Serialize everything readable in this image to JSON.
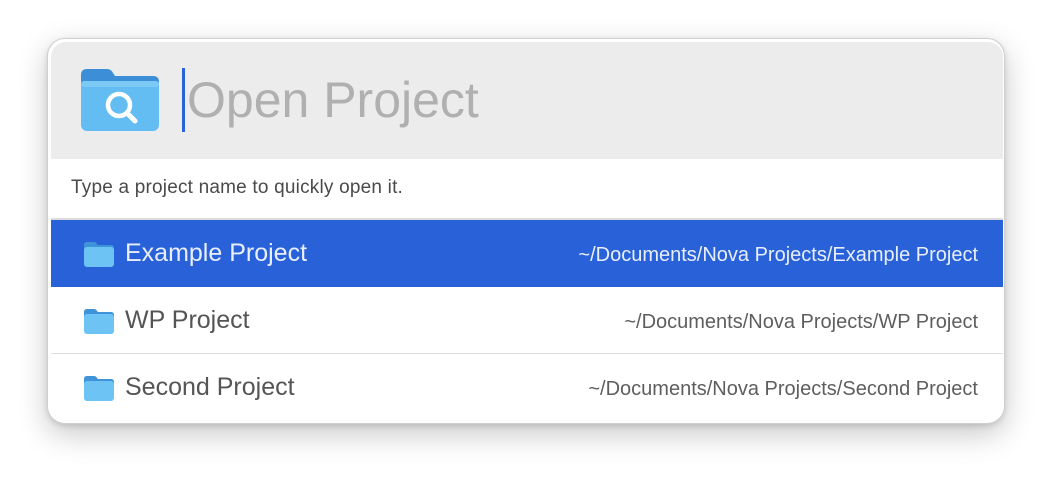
{
  "search": {
    "placeholder": "Open Project",
    "value": "",
    "icon": "folder-search-icon"
  },
  "hint": "Type a project name to quickly open it.",
  "results": [
    {
      "name": "Example Project",
      "path": "~/Documents/Nova Projects/Example Project",
      "icon": "folder-icon",
      "selected": true
    },
    {
      "name": "WP Project",
      "path": "~/Documents/Nova Projects/WP Project",
      "icon": "folder-icon",
      "selected": false
    },
    {
      "name": "Second Project",
      "path": "~/Documents/Nova Projects/Second Project",
      "icon": "folder-icon",
      "selected": false
    }
  ],
  "colors": {
    "accent": "#2962d8",
    "header_bg": "#ececec",
    "folder_blue": "#5cb8f0"
  }
}
